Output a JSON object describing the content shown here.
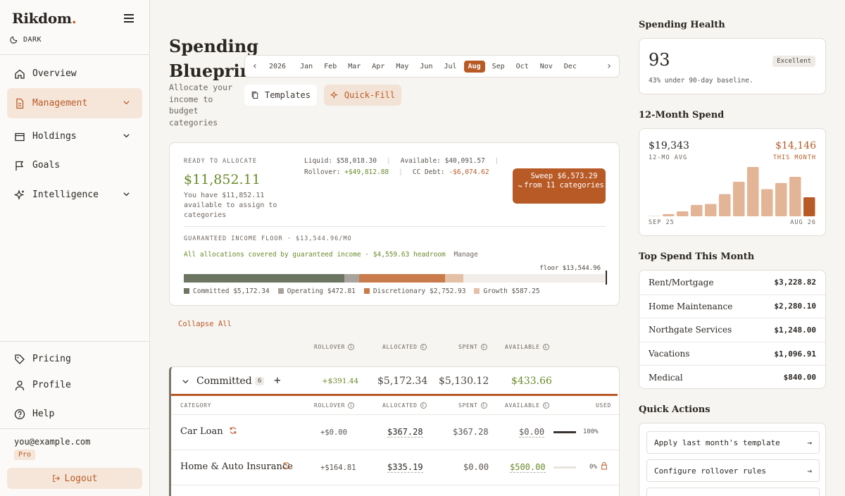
{
  "brand": {
    "name": "Rikdom",
    "dot": "."
  },
  "theme_label": "DARK",
  "nav": {
    "overview": "Overview",
    "management": "Management",
    "holdings": "Holdings",
    "goals": "Goals",
    "intelligence": "Intelligence",
    "pricing": "Pricing",
    "profile": "Profile",
    "help": "Help"
  },
  "user": {
    "email": "you@example.com",
    "plan": "Pro",
    "logout": "Logout"
  },
  "page": {
    "title": "Spending Blueprint",
    "subtitle": "Allocate your income to budget categories"
  },
  "months": {
    "year": "2026",
    "items": [
      "Jan",
      "Feb",
      "Mar",
      "Apr",
      "May",
      "Jun",
      "Jul",
      "Aug",
      "Sep",
      "Oct",
      "Nov",
      "Dec"
    ],
    "selected": "Aug"
  },
  "buttons": {
    "templates": "Templates",
    "quick_fill": "Quick-Fill",
    "collapse_all": "Collapse All"
  },
  "allocate": {
    "label": "READY TO ALLOCATE",
    "amount": "$11,852.11",
    "desc": "You have $11,852.11 available to assign to categories",
    "liquid": "Liquid: $58,018.30",
    "available": "Available: $40,091.57",
    "rollover_label": "Rollover:",
    "rollover_value": "+$49,812.88",
    "ccdebt_label": "CC Debt:",
    "ccdebt_value": "-$6,074.62",
    "sweep": "Sweep $6,573.29 from 11 categories",
    "floor_title": "GUARANTEED INCOME FLOOR · $13,544.96/MO",
    "covered": "All allocations covered by guaranteed income · $4,559.63 headroom",
    "manage": "Manage",
    "floor_label": "floor $13,544.96",
    "floor_value": 13544.96,
    "segments": [
      {
        "name": "Committed",
        "value": 5172.34,
        "label": "Committed $5,172.34",
        "color": "#6b7562"
      },
      {
        "name": "Operating",
        "value": 472.81,
        "label": "Operating $472.81",
        "color": "#a8a49d"
      },
      {
        "name": "Discretionary",
        "value": 2752.93,
        "label": "Discretionary $2,752.93",
        "color": "#c97b4b"
      },
      {
        "name": "Growth",
        "value": 587.25,
        "label": "Growth $587.25",
        "color": "#e3c0a6"
      }
    ]
  },
  "columns": {
    "rollover": "ROLLOVER",
    "allocated": "ALLOCATED",
    "spent": "SPENT",
    "available": "AVAILABLE",
    "category": "CATEGORY",
    "used": "USED"
  },
  "group": {
    "name": "Committed",
    "count": "6",
    "rollover": "+$391.44",
    "allocated": "$5,172.34",
    "spent": "$5,130.12",
    "available": "$433.66"
  },
  "rows": [
    {
      "name": "Car Loan",
      "rollover": "+$0.00",
      "allocated": "$367.28",
      "spent": "$367.28",
      "available": "$0.00",
      "used": "100%",
      "used_frac": 1.0
    },
    {
      "name": "Home & Auto Insurance",
      "rollover": "+$164.81",
      "allocated": "$335.19",
      "spent": "$0.00",
      "available": "$500.00",
      "used": "0%",
      "used_frac": 0.0
    }
  ],
  "health": {
    "title": "Spending Health",
    "score": "93",
    "badge": "Excellent",
    "sub": "43% under 90-day baseline."
  },
  "spend12": {
    "title": "12-Month Spend",
    "avg": "$19,343",
    "avg_label": "12-MO AVG",
    "this": "$14,146",
    "this_label": "THIS MONTH",
    "start": "SEP 25",
    "end": "AUG 26"
  },
  "chart_data": {
    "type": "bar",
    "categories": [
      "Sep",
      "Oct",
      "Nov",
      "Dec",
      "Jan",
      "Feb",
      "Mar",
      "Apr",
      "May",
      "Jun",
      "Jul",
      "Aug"
    ],
    "values": [
      0,
      900,
      2000,
      4600,
      5000,
      9000,
      14000,
      20000,
      11000,
      13500,
      16000,
      7700
    ],
    "xlabel": "",
    "ylabel": "",
    "highlight_last": true,
    "colors": {
      "bar": "#e3b596",
      "highlight": "#b85a26",
      "zero": "#e8e4de"
    }
  },
  "top_spend": {
    "title": "Top Spend This Month",
    "items": [
      {
        "name": "Rent/Mortgage",
        "value": "$3,228.82"
      },
      {
        "name": "Home Maintenance",
        "value": "$2,280.10"
      },
      {
        "name": "Northgate Services",
        "value": "$1,248.00"
      },
      {
        "name": "Vacations",
        "value": "$1,096.91"
      },
      {
        "name": "Medical",
        "value": "$840.00"
      }
    ]
  },
  "quick_actions": {
    "title": "Quick Actions",
    "items": [
      "Apply last month's template",
      "Configure rollover rules"
    ]
  },
  "colors": {
    "accent": "#b85a26",
    "positive": "#6a8a2a",
    "bg": "#f7f5f1"
  }
}
